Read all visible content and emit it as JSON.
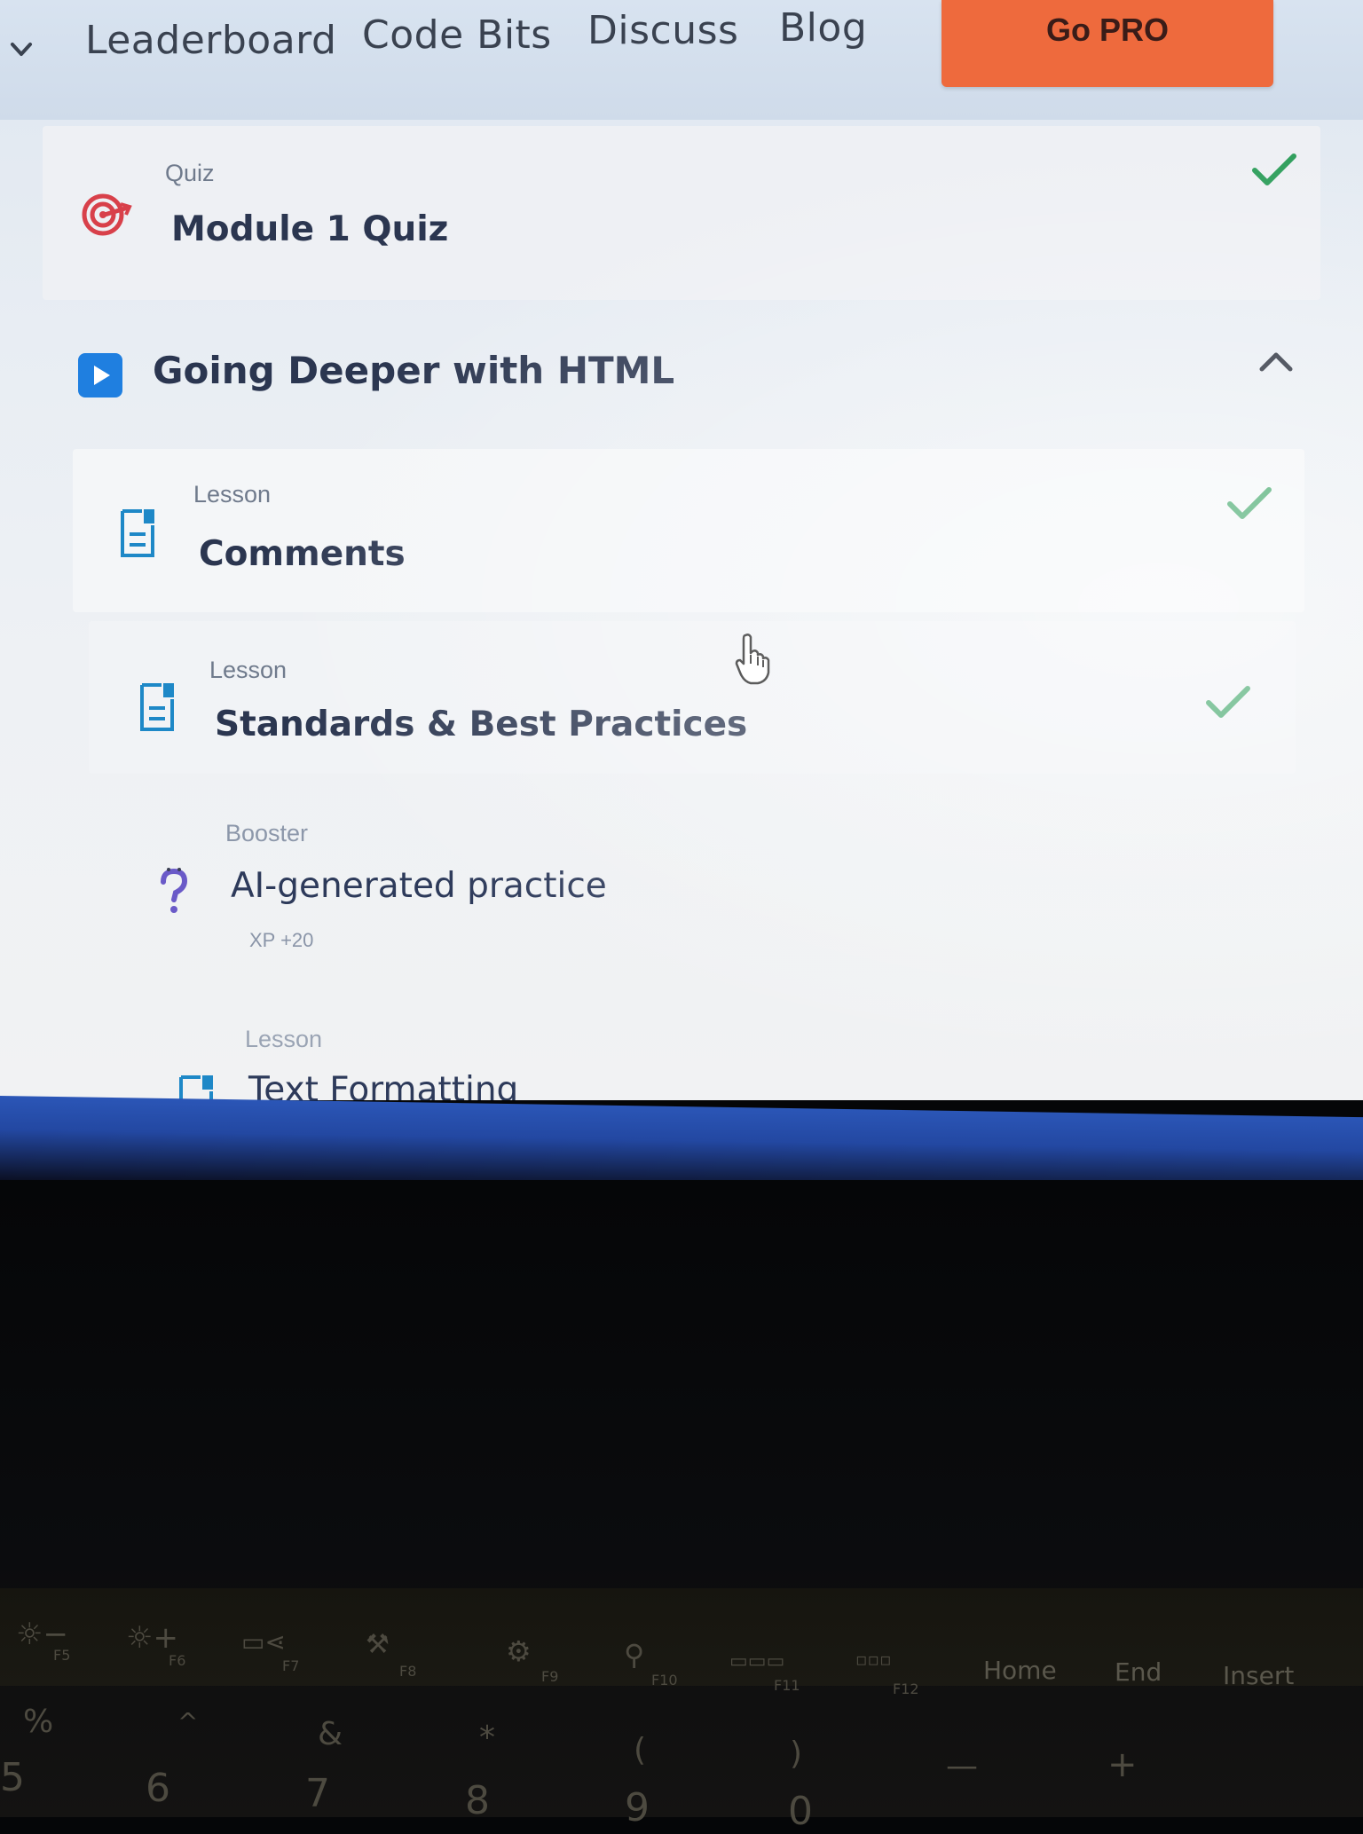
{
  "nav": {
    "links": [
      "Leaderboard",
      "Code Bits",
      "Discuss",
      "Blog"
    ],
    "go_pro": "Go PRO"
  },
  "quiz_item": {
    "type": "Quiz",
    "title": "Module 1 Quiz",
    "completed": true,
    "icon": "target-icon"
  },
  "section": {
    "title": "Going Deeper with HTML",
    "expanded": true,
    "icon": "play-icon"
  },
  "items": [
    {
      "type": "Lesson",
      "title": "Comments",
      "completed": true,
      "icon": "lesson-icon"
    },
    {
      "type": "Lesson",
      "title": "Standards & Best Practices",
      "completed": true,
      "icon": "lesson-icon"
    },
    {
      "type": "Booster",
      "title": "AI-generated practice",
      "xp": "XP +20",
      "icon": "question-icon"
    },
    {
      "type": "Lesson",
      "title": "Text Formatting",
      "icon": "lesson-icon"
    }
  ],
  "keyboard": {
    "fkeys": [
      "F5",
      "F6",
      "F7",
      "F8",
      "F9",
      "F10",
      "F11",
      "F12"
    ],
    "nav_keys": [
      "Home",
      "End",
      "Insert"
    ],
    "number_row": [
      "%",
      "5",
      "^",
      "6",
      "&",
      "7",
      "*",
      "8",
      "(",
      "9",
      ")",
      "0",
      "—",
      "+"
    ]
  },
  "colors": {
    "accent_orange": "#ee6a3d",
    "check_green": "#2e9e5b",
    "lesson_cyan": "#1e88c7",
    "play_blue": "#1f7fe0",
    "quiz_red": "#d8404a",
    "booster_purple": "#6a5ac8"
  }
}
